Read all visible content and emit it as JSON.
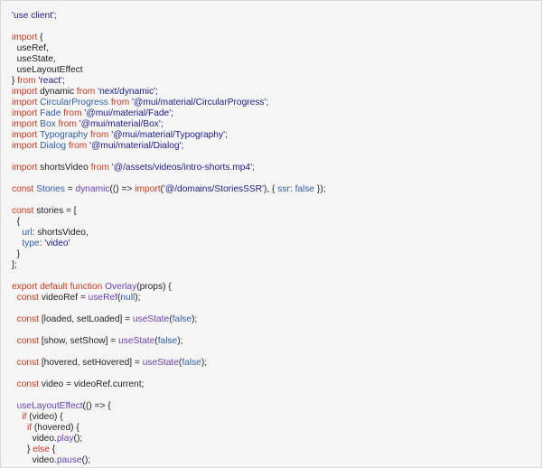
{
  "editor": {
    "background": "#f6f6f6",
    "colors": {
      "keyword": "#c8361d",
      "string": "#1a1a8a",
      "function": "#6a3fb5",
      "component": "#2f5ea8",
      "literal": "#2f5ea8",
      "plain": "#1f1f1f"
    },
    "lines": [
      [
        [
          "str",
          "'use client';"
        ]
      ],
      [],
      [
        [
          "kw",
          "import"
        ],
        [
          "pl",
          " {"
        ]
      ],
      [
        [
          "pl",
          "  useRef,"
        ]
      ],
      [
        [
          "pl",
          "  useState,"
        ]
      ],
      [
        [
          "pl",
          "  useLayoutEffect"
        ]
      ],
      [
        [
          "pl",
          "} "
        ],
        [
          "kw",
          "from"
        ],
        [
          "str",
          " 'react';"
        ]
      ],
      [
        [
          "kw",
          "import"
        ],
        [
          "pl",
          " dynamic "
        ],
        [
          "kw",
          "from"
        ],
        [
          "str",
          " 'next/dynamic';"
        ]
      ],
      [
        [
          "kw",
          "import"
        ],
        [
          "cmp",
          " CircularProgress "
        ],
        [
          "kw",
          "from"
        ],
        [
          "str",
          " '@mui/material/CircularProgress';"
        ]
      ],
      [
        [
          "kw",
          "import"
        ],
        [
          "cmp",
          " Fade "
        ],
        [
          "kw",
          "from"
        ],
        [
          "str",
          " '@mui/material/Fade';"
        ]
      ],
      [
        [
          "kw",
          "import"
        ],
        [
          "cmp",
          " Box "
        ],
        [
          "kw",
          "from"
        ],
        [
          "str",
          " '@mui/material/Box';"
        ]
      ],
      [
        [
          "kw",
          "import"
        ],
        [
          "cmp",
          " Typography "
        ],
        [
          "kw",
          "from"
        ],
        [
          "str",
          " '@mui/material/Typography';"
        ]
      ],
      [
        [
          "kw",
          "import"
        ],
        [
          "cmp",
          " Dialog "
        ],
        [
          "kw",
          "from"
        ],
        [
          "str",
          " '@mui/material/Dialog';"
        ]
      ],
      [],
      [
        [
          "kw",
          "import"
        ],
        [
          "pl",
          " shortsVideo "
        ],
        [
          "kw",
          "from"
        ],
        [
          "str",
          " '@/assets/videos/intro-shorts.mp4';"
        ]
      ],
      [],
      [
        [
          "kw",
          "const"
        ],
        [
          "cmp",
          " Stories"
        ],
        [
          "pl",
          " = "
        ],
        [
          "fn",
          "dynamic"
        ],
        [
          "pl",
          "(() => "
        ],
        [
          "kw",
          "import"
        ],
        [
          "pl",
          "("
        ],
        [
          "str",
          "'@/domains/StoriesSSR'"
        ],
        [
          "pl",
          "), { "
        ],
        [
          "cmp",
          "ssr"
        ],
        [
          "pl",
          ": "
        ],
        [
          "lit",
          "false"
        ],
        [
          "pl",
          " });"
        ]
      ],
      [],
      [
        [
          "kw",
          "const"
        ],
        [
          "pl",
          " stories = ["
        ]
      ],
      [
        [
          "pl",
          "  {"
        ]
      ],
      [
        [
          "cmp",
          "    url"
        ],
        [
          "pl",
          ": shortsVideo,"
        ]
      ],
      [
        [
          "cmp",
          "    type"
        ],
        [
          "pl",
          ": "
        ],
        [
          "str",
          "'video'"
        ]
      ],
      [
        [
          "pl",
          "  }"
        ]
      ],
      [
        [
          "pl",
          "];"
        ]
      ],
      [],
      [
        [
          "kw",
          "export default function"
        ],
        [
          "fn",
          " Overlay"
        ],
        [
          "pl",
          "(props) {"
        ]
      ],
      [
        [
          "kw",
          "  const"
        ],
        [
          "pl",
          " videoRef = "
        ],
        [
          "fn",
          "useRef"
        ],
        [
          "pl",
          "("
        ],
        [
          "lit",
          "null"
        ],
        [
          "pl",
          ");"
        ]
      ],
      [],
      [
        [
          "kw",
          "  const"
        ],
        [
          "pl",
          " [loaded, setLoaded] = "
        ],
        [
          "fn",
          "useState"
        ],
        [
          "pl",
          "("
        ],
        [
          "lit",
          "false"
        ],
        [
          "pl",
          ");"
        ]
      ],
      [],
      [
        [
          "kw",
          "  const"
        ],
        [
          "pl",
          " [show, setShow] = "
        ],
        [
          "fn",
          "useState"
        ],
        [
          "pl",
          "("
        ],
        [
          "lit",
          "false"
        ],
        [
          "pl",
          ");"
        ]
      ],
      [],
      [
        [
          "kw",
          "  const"
        ],
        [
          "pl",
          " [hovered, setHovered] = "
        ],
        [
          "fn",
          "useState"
        ],
        [
          "pl",
          "("
        ],
        [
          "lit",
          "false"
        ],
        [
          "pl",
          ");"
        ]
      ],
      [],
      [
        [
          "kw",
          "  const"
        ],
        [
          "pl",
          " video = videoRef.current;"
        ]
      ],
      [],
      [
        [
          "fn",
          "  useLayoutEffect"
        ],
        [
          "pl",
          "(() => {"
        ]
      ],
      [
        [
          "kw",
          "    if"
        ],
        [
          "pl",
          " (video) {"
        ]
      ],
      [
        [
          "kw",
          "      if"
        ],
        [
          "pl",
          " (hovered) {"
        ]
      ],
      [
        [
          "pl",
          "        video."
        ],
        [
          "fn",
          "play"
        ],
        [
          "pl",
          "();"
        ]
      ],
      [
        [
          "pl",
          "      } "
        ],
        [
          "kw",
          "else"
        ],
        [
          "pl",
          " {"
        ]
      ],
      [
        [
          "pl",
          "        video."
        ],
        [
          "fn",
          "pause"
        ],
        [
          "pl",
          "();"
        ]
      ]
    ]
  }
}
